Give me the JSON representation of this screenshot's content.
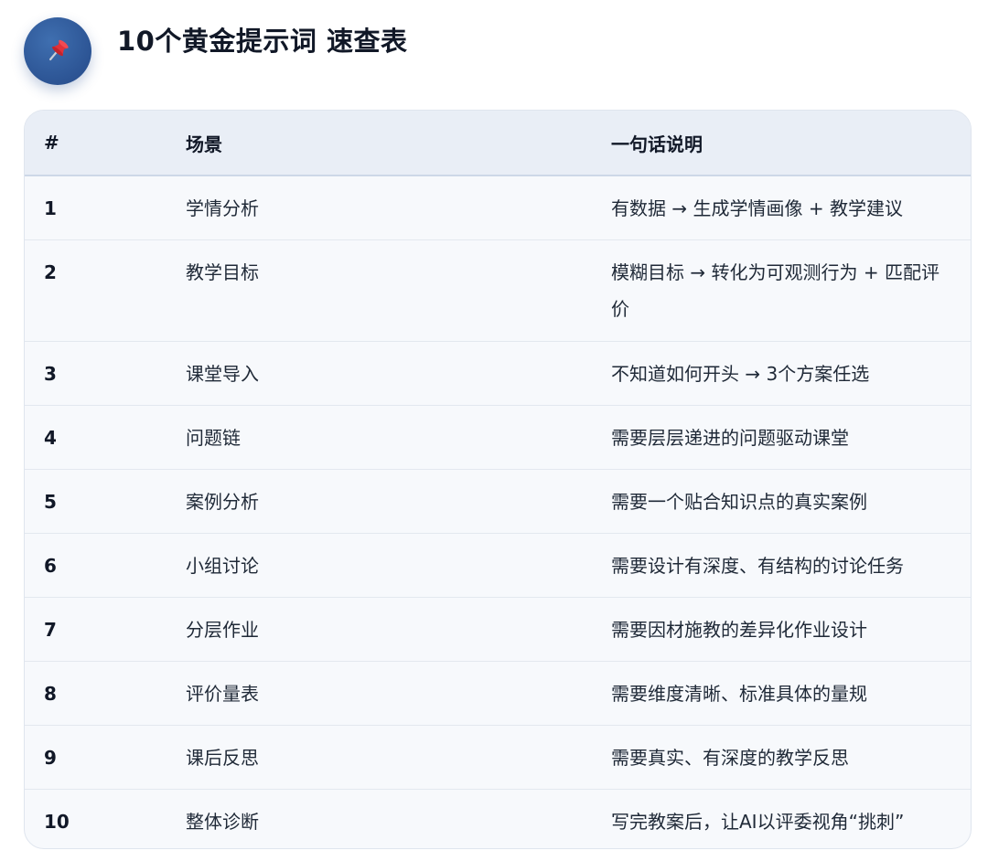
{
  "title": "10个黄金提示词 速查表",
  "header_icon": "pushpin-icon",
  "colors": {
    "badge": "#2c5494",
    "header_bg": "#e9eef6",
    "row_bg": "#f7f9fc"
  },
  "table": {
    "headers": [
      "#",
      "场景",
      "一句话说明"
    ],
    "rows": [
      {
        "num": "1",
        "scene": "学情分析",
        "desc": "有数据 → 生成学情画像 + 教学建议"
      },
      {
        "num": "2",
        "scene": "教学目标",
        "desc": "模糊目标 → 转化为可观测行为 + 匹配评价"
      },
      {
        "num": "3",
        "scene": "课堂导入",
        "desc": "不知道如何开头 → 3个方案任选"
      },
      {
        "num": "4",
        "scene": "问题链",
        "desc": "需要层层递进的问题驱动课堂"
      },
      {
        "num": "5",
        "scene": "案例分析",
        "desc": "需要一个贴合知识点的真实案例"
      },
      {
        "num": "6",
        "scene": "小组讨论",
        "desc": "需要设计有深度、有结构的讨论任务"
      },
      {
        "num": "7",
        "scene": "分层作业",
        "desc": "需要因材施教的差异化作业设计"
      },
      {
        "num": "8",
        "scene": "评价量表",
        "desc": "需要维度清晰、标准具体的量规"
      },
      {
        "num": "9",
        "scene": "课后反思",
        "desc": "需要真实、有深度的教学反思"
      },
      {
        "num": "10",
        "scene": "整体诊断",
        "desc": "写完教案后，让AI以评委视角“挑刺”"
      }
    ]
  }
}
